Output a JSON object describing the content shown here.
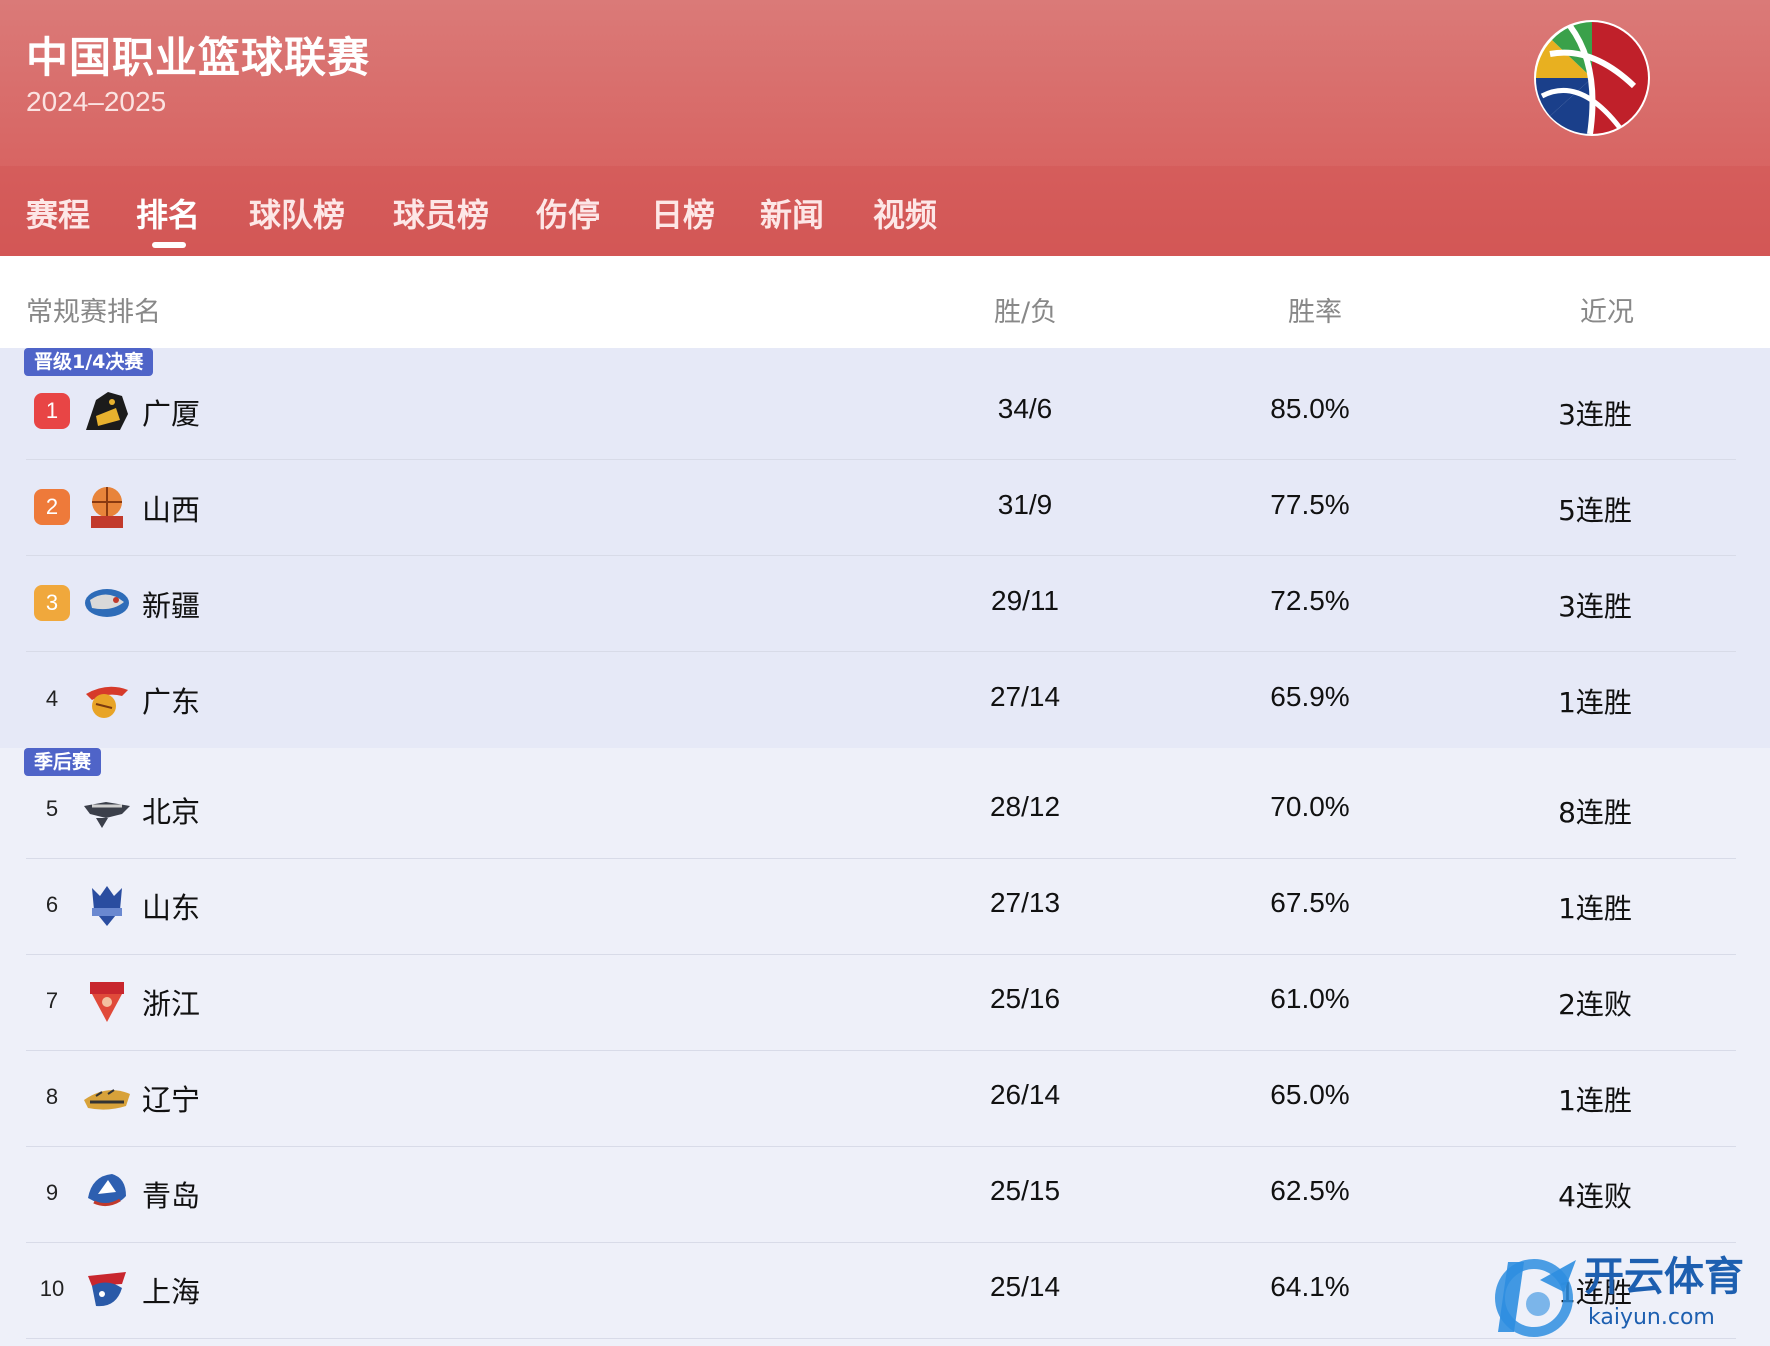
{
  "app": {
    "title": "中国职业篮球联赛",
    "season": "2024–2025"
  },
  "nav": {
    "tabs": [
      "赛程",
      "排名",
      "球队榜",
      "球员榜",
      "伤停",
      "日榜",
      "新闻",
      "视频"
    ],
    "active_index": 1
  },
  "table": {
    "section_title": "常规赛排名",
    "columns": [
      "胜/负",
      "胜率",
      "近况"
    ],
    "groups": [
      {
        "tag": "晋级1/4决赛"
      },
      {
        "tag": "季后赛"
      }
    ],
    "rows": [
      {
        "rank": "1",
        "team": "广厦",
        "wl": "34/6",
        "pct": "85.0%",
        "streak": "3连胜"
      },
      {
        "rank": "2",
        "team": "山西",
        "wl": "31/9",
        "pct": "77.5%",
        "streak": "5连胜"
      },
      {
        "rank": "3",
        "team": "新疆",
        "wl": "29/11",
        "pct": "72.5%",
        "streak": "3连胜"
      },
      {
        "rank": "4",
        "team": "广东",
        "wl": "27/14",
        "pct": "65.9%",
        "streak": "1连胜"
      },
      {
        "rank": "5",
        "team": "北京",
        "wl": "28/12",
        "pct": "70.0%",
        "streak": "8连胜"
      },
      {
        "rank": "6",
        "team": "山东",
        "wl": "27/13",
        "pct": "67.5%",
        "streak": "1连胜"
      },
      {
        "rank": "7",
        "team": "浙江",
        "wl": "25/16",
        "pct": "61.0%",
        "streak": "2连败"
      },
      {
        "rank": "8",
        "team": "辽宁",
        "wl": "26/14",
        "pct": "65.0%",
        "streak": "1连胜"
      },
      {
        "rank": "9",
        "team": "青岛",
        "wl": "25/15",
        "pct": "62.5%",
        "streak": "4连败"
      },
      {
        "rank": "10",
        "team": "上海",
        "wl": "25/14",
        "pct": "64.1%",
        "streak": "1连胜"
      }
    ]
  },
  "colors": {
    "header": "#d86664",
    "rank1": "#e84545",
    "rank2": "#ee7a3a",
    "rank3": "#f0a83c",
    "tag": "#4f64c8"
  },
  "watermark": {
    "brand": "开云体育",
    "site": "kaiyun.com"
  }
}
